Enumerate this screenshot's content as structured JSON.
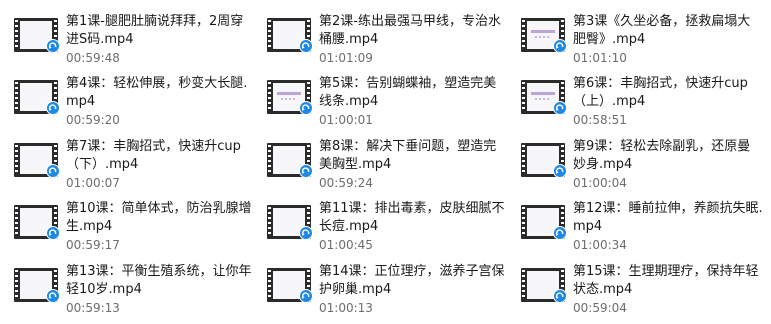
{
  "files": [
    {
      "name": "第1课-腿肥肚腩说拜拜，2周穿进S码.mp4",
      "duration": "00:59:48",
      "thumbnail": "blank"
    },
    {
      "name": "第2课-练出最强马甲线，专治水桶腰.mp4",
      "duration": "01:01:09",
      "thumbnail": "blank"
    },
    {
      "name": "第3课《久坐必备，拯救扁塌大肥臀》.mp4",
      "duration": "01:01:10",
      "thumbnail": "slide"
    },
    {
      "name": "第4课：轻松伸展，秒变大长腿.mp4",
      "duration": "00:59:20",
      "thumbnail": "blank"
    },
    {
      "name": "第5课：告别蝴蝶袖，塑造完美线条.mp4",
      "duration": "01:00:01",
      "thumbnail": "slide"
    },
    {
      "name": "第6课：丰胸招式，快速升cup（上）.mp4",
      "duration": "00:58:51",
      "thumbnail": "slide"
    },
    {
      "name": "第7课：丰胸招式，快速升cup（下）.mp4",
      "duration": "01:00:07",
      "thumbnail": "blank"
    },
    {
      "name": "第8课：解决下垂问题，塑造完美胸型.mp4",
      "duration": "00:59:24",
      "thumbnail": "blank"
    },
    {
      "name": "第9课：轻松去除副乳，还原曼妙身.mp4",
      "duration": "01:00:04",
      "thumbnail": "blank"
    },
    {
      "name": "第10课：简单体式，防治乳腺增生.mp4",
      "duration": "00:59:17",
      "thumbnail": "blank"
    },
    {
      "name": "第11课：排出毒素，皮肤细腻不长痘.mp4",
      "duration": "01:00:45",
      "thumbnail": "blank"
    },
    {
      "name": "第12课：睡前拉伸，养颜抗失眠.mp4",
      "duration": "01:00:34",
      "thumbnail": "blank"
    },
    {
      "name": "第13课：平衡生殖系统，让你年轻10岁.mp4",
      "duration": "00:59:13",
      "thumbnail": "blank"
    },
    {
      "name": "第14课：正位理疗，滋养子宫保护卵巢.mp4",
      "duration": "01:00:13",
      "thumbnail": "blank"
    },
    {
      "name": "第15课：生理期理疗，保持年轻状态.mp4",
      "duration": "00:59:04",
      "thumbnail": "blank"
    }
  ],
  "icons": {
    "file_type": "video-file-icon",
    "open_with_badge": "media-player-badge-icon"
  },
  "colors": {
    "badge": "#1e88e5",
    "film": "#2b2b2b",
    "filename_text": "#1a1a1a",
    "duration_text": "#6d6d6d"
  }
}
